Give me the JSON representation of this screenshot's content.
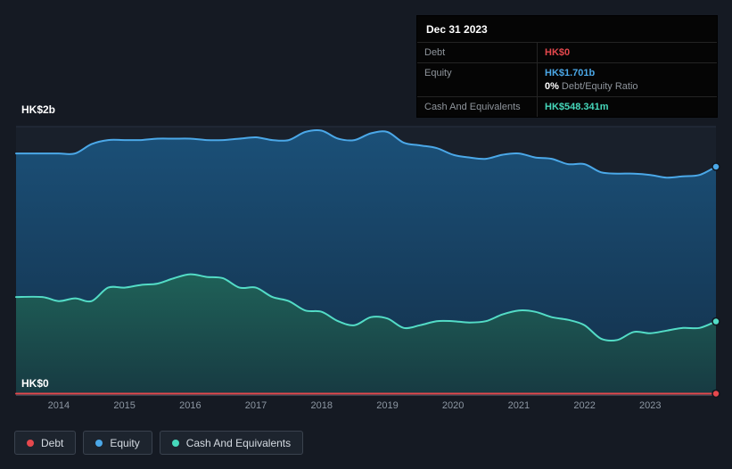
{
  "page": {
    "background": "#151a23"
  },
  "tooltip": {
    "date": "Dec 31 2023",
    "rows": [
      {
        "label": "Debt",
        "value": "HK$0",
        "color": "#e5484d"
      },
      {
        "label": "Equity",
        "value": "HK$1.701b",
        "color": "#4ba8e8",
        "sub_bold": "0%",
        "sub_rest": "Debt/Equity Ratio"
      },
      {
        "label": "Cash And Equivalents",
        "value": "HK$548.341m",
        "color": "#46d8bb"
      }
    ]
  },
  "legend": {
    "items": [
      {
        "label": "Debt",
        "color": "#e5484d"
      },
      {
        "label": "Equity",
        "color": "#4ba8e8"
      },
      {
        "label": "Cash And Equivalents",
        "color": "#46d8bb"
      }
    ]
  },
  "chart_data": {
    "type": "area",
    "unit": "HK$ billions",
    "x_domain": [
      2013.35,
      2024
    ],
    "y_domain": [
      0,
      2
    ],
    "y_ticks": [
      {
        "value": 2,
        "label": "HK$2b"
      },
      {
        "value": 0,
        "label": "HK$0"
      }
    ],
    "y_gridlines": [
      2,
      1
    ],
    "x_tick_labels": [
      "2014",
      "2015",
      "2016",
      "2017",
      "2018",
      "2019",
      "2020",
      "2021",
      "2022",
      "2023"
    ],
    "x": [
      2013.35,
      2013.75,
      2014,
      2014.25,
      2014.5,
      2014.75,
      2015,
      2015.25,
      2015.5,
      2015.75,
      2016,
      2016.25,
      2016.5,
      2016.75,
      2017,
      2017.25,
      2017.5,
      2017.75,
      2018,
      2018.25,
      2018.5,
      2018.75,
      2019,
      2019.25,
      2019.5,
      2019.75,
      2020,
      2020.25,
      2020.5,
      2020.75,
      2021,
      2021.25,
      2021.5,
      2021.75,
      2022,
      2022.25,
      2022.5,
      2022.75,
      2023,
      2023.25,
      2023.5,
      2023.75,
      2024
    ],
    "series": [
      {
        "name": "Debt",
        "color": "#e5484d",
        "values": [
          0,
          0,
          0,
          0,
          0,
          0,
          0,
          0,
          0,
          0,
          0,
          0,
          0,
          0,
          0,
          0,
          0,
          0,
          0,
          0,
          0,
          0,
          0,
          0,
          0,
          0,
          0,
          0,
          0,
          0,
          0,
          0,
          0,
          0,
          0,
          0,
          0,
          0,
          0,
          0,
          0,
          0,
          0
        ]
      },
      {
        "name": "Equity",
        "color": "#4ba8e8",
        "fill_top": "#1b5078",
        "fill_bottom": "#13304a",
        "values": [
          1.8,
          1.8,
          1.8,
          1.8,
          1.87,
          1.9,
          1.9,
          1.9,
          1.91,
          1.91,
          1.91,
          1.9,
          1.9,
          1.91,
          1.92,
          1.9,
          1.9,
          1.96,
          1.97,
          1.91,
          1.9,
          1.95,
          1.96,
          1.88,
          1.86,
          1.84,
          1.79,
          1.77,
          1.76,
          1.79,
          1.8,
          1.77,
          1.76,
          1.72,
          1.72,
          1.66,
          1.65,
          1.65,
          1.64,
          1.62,
          1.63,
          1.64,
          1.701
        ]
      },
      {
        "name": "Cash And Equivalents",
        "color": "#53dcc6",
        "fill_top": "#1f6158",
        "fill_bottom": "#173a42",
        "values": [
          0.73,
          0.73,
          0.7,
          0.72,
          0.7,
          0.8,
          0.8,
          0.82,
          0.83,
          0.87,
          0.9,
          0.88,
          0.87,
          0.8,
          0.8,
          0.73,
          0.7,
          0.63,
          0.62,
          0.55,
          0.52,
          0.58,
          0.57,
          0.5,
          0.52,
          0.55,
          0.55,
          0.54,
          0.55,
          0.6,
          0.63,
          0.62,
          0.58,
          0.56,
          0.52,
          0.42,
          0.41,
          0.47,
          0.46,
          0.48,
          0.5,
          0.5,
          0.548
        ]
      }
    ]
  }
}
